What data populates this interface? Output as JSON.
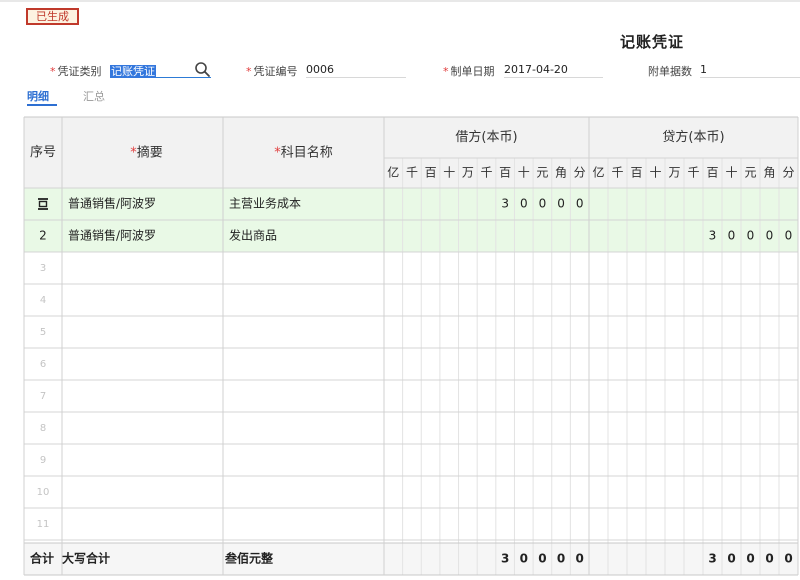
{
  "status_badge": "已生成",
  "doc_title": "记账凭证",
  "header_fields": {
    "type_label": "凭证类别",
    "type_value": "记账凭证",
    "number_label": "凭证编号",
    "number_value": "0006",
    "date_label": "制单日期",
    "date_value": "2017-04-20",
    "attach_label": "附单据数",
    "attach_value": "1"
  },
  "tabs": [
    {
      "label": "明细",
      "active": true
    },
    {
      "label": "汇总",
      "active": false
    }
  ],
  "table": {
    "col_seq": "序号",
    "col_summary": "摘要",
    "col_account": "科目名称",
    "debit_title": "借方(本币)",
    "credit_title": "贷方(本币)",
    "units": [
      "亿",
      "千",
      "百",
      "十",
      "万",
      "千",
      "百",
      "十",
      "元",
      "角",
      "分"
    ],
    "rows": [
      {
        "seq": "",
        "summary": "普通销售/阿波罗",
        "account": "主营业务成本",
        "debit": [
          "",
          "",
          "",
          "",
          "",
          "",
          "3",
          "0",
          "0",
          "0",
          "0"
        ],
        "credit": [
          "",
          "",
          "",
          "",
          "",
          "",
          "",
          "",
          "",
          "",
          ""
        ]
      },
      {
        "seq": "2",
        "summary": "普通销售/阿波罗",
        "account": "发出商品",
        "debit": [
          "",
          "",
          "",
          "",
          "",
          "",
          "",
          "",
          "",
          "",
          ""
        ],
        "credit": [
          "",
          "",
          "",
          "",
          "",
          "",
          "3",
          "0",
          "0",
          "0",
          "0"
        ]
      },
      {
        "seq": "3",
        "summary": "",
        "account": "",
        "debit": [],
        "credit": []
      },
      {
        "seq": "4",
        "summary": "",
        "account": "",
        "debit": [],
        "credit": []
      },
      {
        "seq": "5",
        "summary": "",
        "account": "",
        "debit": [],
        "credit": []
      },
      {
        "seq": "6",
        "summary": "",
        "account": "",
        "debit": [],
        "credit": []
      },
      {
        "seq": "7",
        "summary": "",
        "account": "",
        "debit": [],
        "credit": []
      },
      {
        "seq": "8",
        "summary": "",
        "account": "",
        "debit": [],
        "credit": []
      },
      {
        "seq": "9",
        "summary": "",
        "account": "",
        "debit": [],
        "credit": []
      },
      {
        "seq": "10",
        "summary": "",
        "account": "",
        "debit": [],
        "credit": []
      },
      {
        "seq": "11",
        "summary": "",
        "account": "",
        "debit": [],
        "credit": []
      }
    ],
    "total": {
      "label": "合计",
      "capital_label": "大写合计",
      "capital_value": "叁佰元整",
      "debit": [
        "",
        "",
        "",
        "",
        "",
        "",
        "3",
        "0",
        "0",
        "0",
        "0"
      ],
      "credit": [
        "",
        "",
        "",
        "",
        "",
        "",
        "3",
        "0",
        "0",
        "0",
        "0"
      ]
    }
  },
  "colors": {
    "highlight_row": "#e9f9e6",
    "header_bg": "#f2f2f2",
    "accent": "#2d6fd2",
    "required": "#e03a3a"
  }
}
